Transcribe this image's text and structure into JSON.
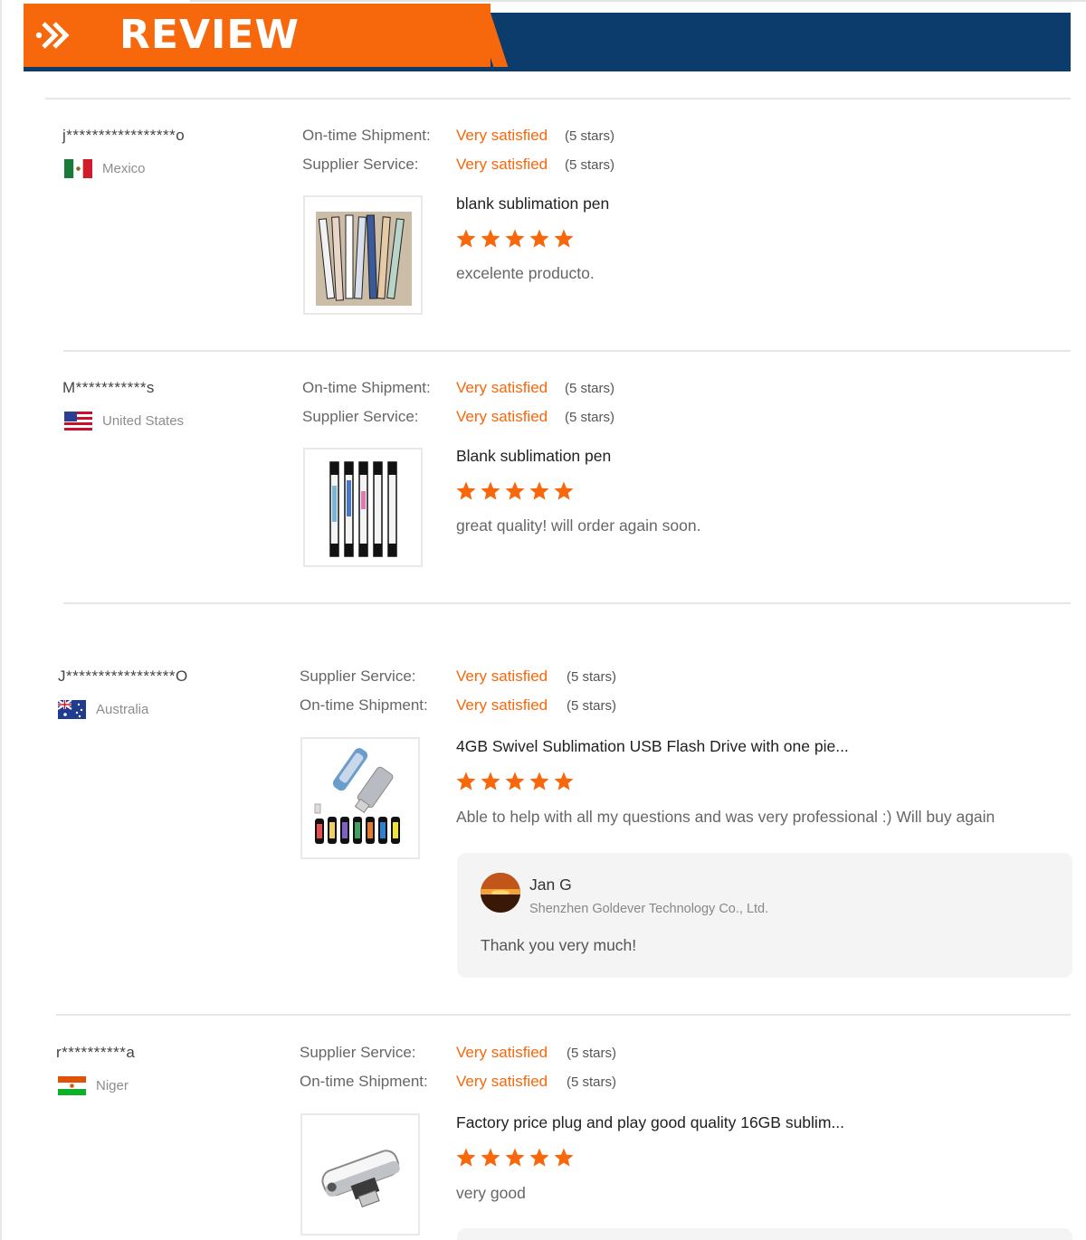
{
  "header": {
    "title": "REVIEW",
    "icon": "double-chevron-right-icon"
  },
  "colors": {
    "accent_orange": "#f7670c",
    "navy": "#0c3c6c",
    "star": "#f7670c"
  },
  "reviews": [
    {
      "reviewer": "j*****************o",
      "country": "Mexico",
      "flag": "mexico-flag-icon",
      "ratings": [
        {
          "label": "On-time Shipment:",
          "value": "Very satisfied",
          "stars": "(5 stars)"
        },
        {
          "label": "Supplier Service:",
          "value": "Very satisfied",
          "stars": "(5 stars)"
        }
      ],
      "product": {
        "title": "blank sublimation pen",
        "rating": 5,
        "thumb": "sublimation-pens-image"
      },
      "comment": "excelente producto."
    },
    {
      "reviewer": "M***********s",
      "country": "United States",
      "flag": "usa-flag-icon",
      "ratings": [
        {
          "label": "On-time Shipment:",
          "value": "Very satisfied",
          "stars": "(5 stars)"
        },
        {
          "label": "Supplier Service:",
          "value": "Very satisfied",
          "stars": "(5 stars)"
        }
      ],
      "product": {
        "title": "Blank sublimation pen",
        "rating": 5,
        "thumb": "white-pens-image"
      },
      "comment": "great quality! will order again soon."
    },
    {
      "reviewer": "J*****************O",
      "country": "Australia",
      "flag": "australia-flag-icon",
      "ratings": [
        {
          "label": "Supplier Service:",
          "value": "Very satisfied",
          "stars": "(5 stars)"
        },
        {
          "label": "On-time Shipment:",
          "value": "Very satisfied",
          "stars": "(5 stars)"
        }
      ],
      "product": {
        "title": "4GB Swivel Sublimation USB Flash Drive with one pie...",
        "rating": 5,
        "thumb": "usb-flash-drives-image"
      },
      "comment": "Able to help with all my questions and was very professional :) Will buy again",
      "reply": {
        "name": "Jan G",
        "company": "Shenzhen Goldever Technology Co., Ltd.",
        "text": "Thank you very much!"
      }
    },
    {
      "reviewer": "r**********a",
      "country": "Niger",
      "flag": "niger-flag-icon",
      "ratings": [
        {
          "label": "Supplier Service:",
          "value": "Very satisfied",
          "stars": "(5 stars)"
        },
        {
          "label": "On-time Shipment:",
          "value": "Very satisfied",
          "stars": "(5 stars)"
        }
      ],
      "product": {
        "title": "Factory price plug and play good quality 16GB sublim...",
        "rating": 5,
        "thumb": "swivel-usb-drive-image"
      },
      "comment": "very good"
    }
  ]
}
